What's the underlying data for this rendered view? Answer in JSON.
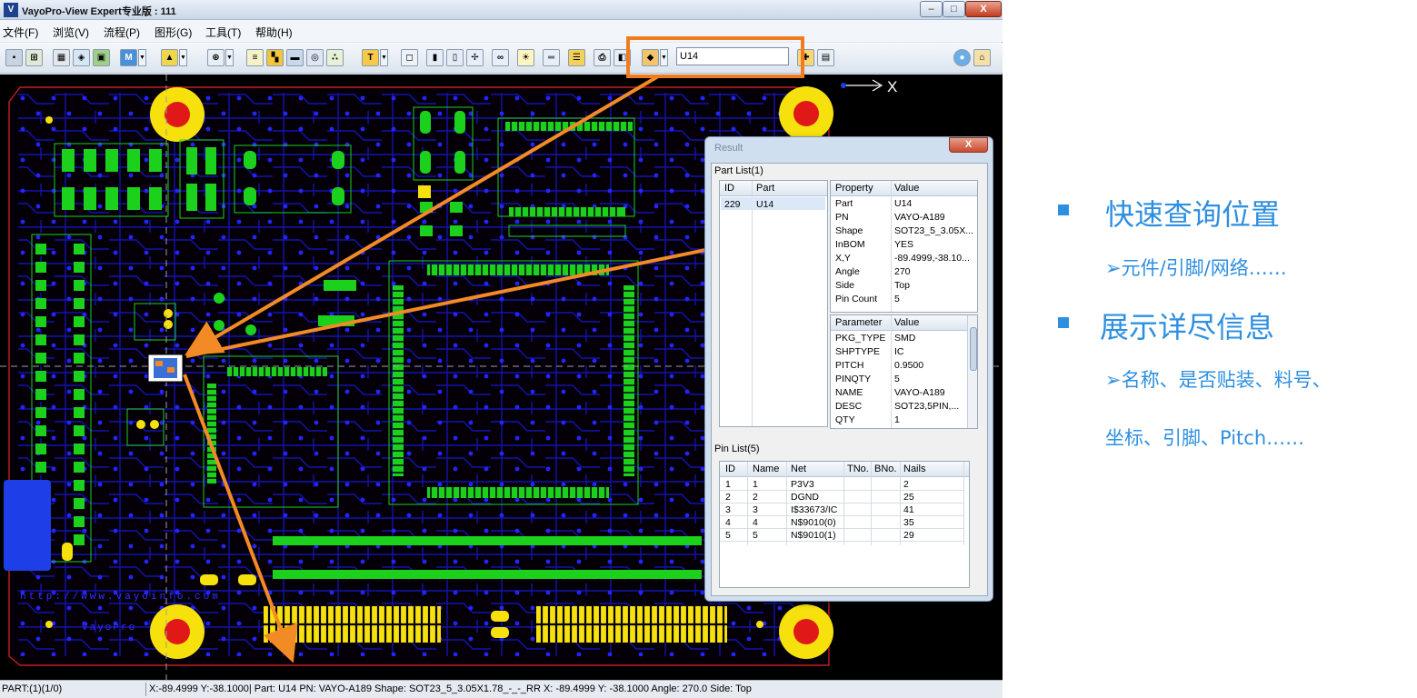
{
  "window": {
    "title": "VayoPro-View Expert专业版 : 111",
    "app_icon": "V",
    "minimize": "–",
    "maximize": "□",
    "close": "X"
  },
  "menu": [
    "文件(F)",
    "浏览(V)",
    "流程(P)",
    "图形(G)",
    "工具(T)",
    "帮助(H)"
  ],
  "toolbar": {
    "search_value": "U14",
    "accent_color": "#f07c1e"
  },
  "canvas": {
    "axis_label": "X",
    "watermark_url": "http://www.vayoinfo.com",
    "watermark_brand": "VayoPro"
  },
  "statusbar": {
    "left": "PART:(1)(1/0)",
    "right": "X:-89.4999 Y:-38.1000| Part: U14 PN: VAYO-A189 Shape: SOT23_5_3.05X1.78_-_-_RR X: -89.4999 Y: -38.1000 Angle: 270.0 Side: Top"
  },
  "result": {
    "title": "Result",
    "close": "X",
    "part_list_label": "Part List(1)",
    "part_list_headers": [
      "ID",
      "Part"
    ],
    "part_list_rows": [
      [
        "229",
        "U14"
      ]
    ],
    "property_headers": [
      "Property",
      "Value"
    ],
    "properties": [
      [
        "Part",
        "U14"
      ],
      [
        "PN",
        "VAYO-A189"
      ],
      [
        "Shape",
        "SOT23_5_3.05X..."
      ],
      [
        "InBOM",
        "YES"
      ],
      [
        "X,Y",
        "-89.4999,-38.10..."
      ],
      [
        "Angle",
        "270"
      ],
      [
        "Side",
        "Top"
      ],
      [
        "Pin Count",
        "5"
      ]
    ],
    "parameter_headers": [
      "Parameter",
      "Value"
    ],
    "parameters": [
      [
        "PKG_TYPE",
        "SMD"
      ],
      [
        "SHPTYPE",
        "IC"
      ],
      [
        "PITCH",
        "0.9500"
      ],
      [
        "PINQTY",
        "5"
      ],
      [
        "NAME",
        "VAYO-A189"
      ],
      [
        "DESC",
        "SOT23,5PIN,..."
      ],
      [
        "QTY",
        "1"
      ]
    ],
    "pin_list_label": "Pin List(5)",
    "pin_headers": [
      "ID",
      "Name",
      "Net",
      "TNo.",
      "BNo.",
      "Nails"
    ],
    "pins": [
      [
        "1",
        "1",
        "P3V3",
        "",
        "",
        "2"
      ],
      [
        "2",
        "2",
        "DGND",
        "",
        "",
        "25"
      ],
      [
        "3",
        "3",
        "I$33673/IC",
        "",
        "",
        "41"
      ],
      [
        "4",
        "4",
        "N$9010(0)",
        "",
        "",
        "35"
      ],
      [
        "5",
        "5",
        "N$9010(1)",
        "",
        "",
        "29"
      ]
    ]
  },
  "annotations": {
    "heading1": "快速查询位置",
    "sub1": "➢元件/引脚/网络……",
    "heading2": "展示详尽信息",
    "sub2": "➢名称、是否贴装、料号、",
    "sub3": "坐标、引脚、Pitch……",
    "color": "#2e8fe0"
  }
}
